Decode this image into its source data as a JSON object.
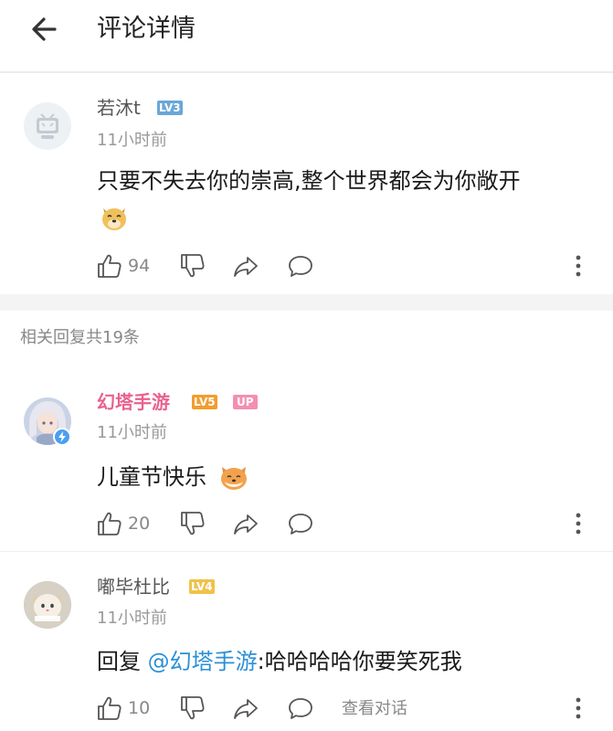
{
  "header": {
    "title": "评论详情"
  },
  "main_comment": {
    "username": "若沐t",
    "level": "LV3",
    "time": "11小时前",
    "text": "只要不失去你的崇高,整个世界都会为你敞开",
    "likes": "94"
  },
  "section_title": "相关回复共19条",
  "replies": [
    {
      "username": "幻塔手游",
      "level": "LV5",
      "up_badge": "UP",
      "time": "11小时前",
      "text": "儿童节快乐",
      "likes": "20"
    },
    {
      "username": "嘟毕杜比",
      "level": "LV4",
      "time": "11小时前",
      "reply_prefix": "回复 ",
      "mention": "@幻塔手游",
      "text": ":哈哈哈哈你要笑死我",
      "likes": "10",
      "view_dialog": "查看对话"
    }
  ],
  "colors": {
    "up_name": "#e8628e",
    "mention": "#2b8fd6",
    "lv3": "#6aa7d8",
    "lv4": "#f0c24a",
    "lv5": "#f39c2f",
    "up_badge": "#f48fb1"
  },
  "icons": [
    "back-arrow-icon",
    "thumbs-up-icon",
    "thumbs-down-icon",
    "share-icon",
    "comment-icon",
    "more-vertical-icon",
    "doge-emoji",
    "shiba-emoji",
    "verified-icon"
  ]
}
